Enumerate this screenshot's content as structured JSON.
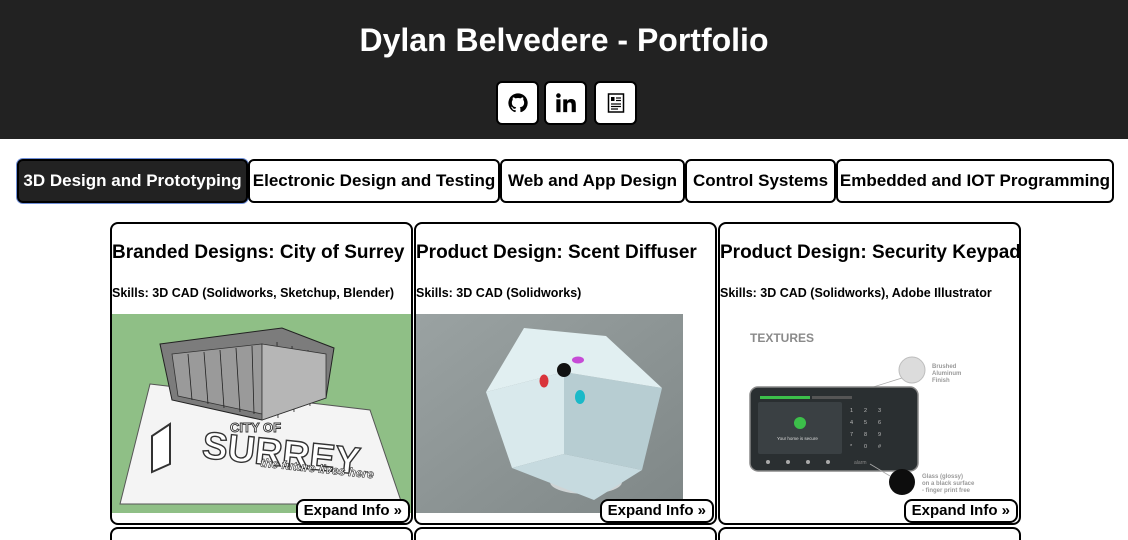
{
  "header": {
    "title": "Dylan Belvedere - Portfolio",
    "social": [
      {
        "icon": "github-icon"
      },
      {
        "icon": "linkedin-icon"
      },
      {
        "icon": "resume-icon"
      }
    ],
    "background": "#222222"
  },
  "tabs": [
    {
      "label": "3D Design and Prototyping",
      "active": true
    },
    {
      "label": "Electronic Design and Testing",
      "active": false
    },
    {
      "label": "Web and App Design",
      "active": false
    },
    {
      "label": "Control Systems",
      "active": false
    },
    {
      "label": "Embedded and IOT Programming",
      "active": false
    }
  ],
  "cards": [
    {
      "title": "Branded Designs: City of Surrey",
      "skills": "Skills: 3D CAD (Solidworks, Sketchup, Blender)",
      "image_text_1": "CITY OF",
      "image_text_2": "SURREY",
      "image_text_3": "the future lives here",
      "expand_label": "Expand Info »"
    },
    {
      "title": "Product Design: Scent Diffuser",
      "skills": "Skills: 3D CAD (Solidworks)",
      "expand_label": "Expand Info »"
    },
    {
      "title": "Product Design: Security Keypad",
      "skills": "Skills: 3D CAD (Solidworks), Adobe Illustrator",
      "image_heading": "TEXTURES",
      "callout_1": [
        "Brushed",
        "Aluminum",
        "Finish"
      ],
      "callout_2": [
        "Glass (glossy)",
        "on a black surface",
        "- finger print free"
      ],
      "screen_text": "Your home is secure",
      "keys": [
        "1",
        "2",
        "3",
        "4",
        "5",
        "6",
        "7",
        "8",
        "9",
        "*",
        "0",
        "#"
      ],
      "brand": "alarm",
      "expand_label": "Expand Info »"
    }
  ]
}
